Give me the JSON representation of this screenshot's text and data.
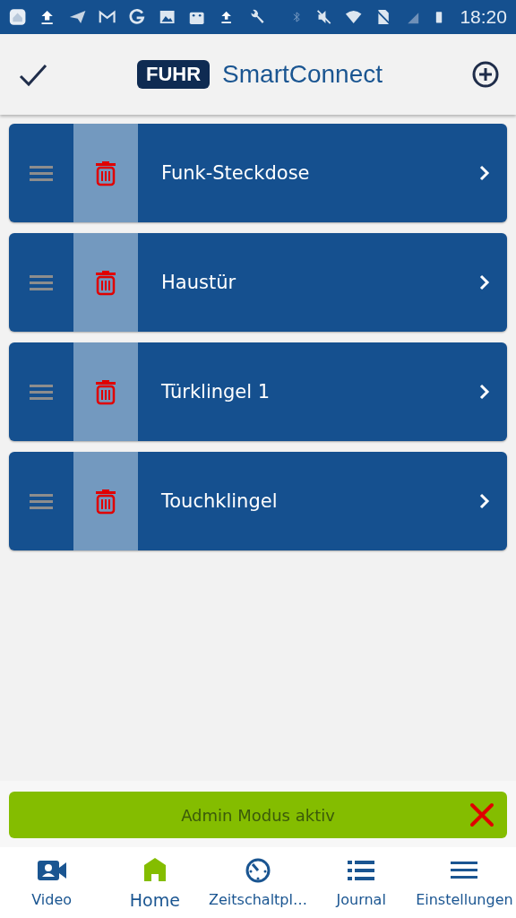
{
  "status_bar": {
    "time": "18:20"
  },
  "header": {
    "brand_badge": "FUHR",
    "brand_name": "SmartConnect"
  },
  "devices": [
    {
      "name": "Funk-Steckdose"
    },
    {
      "name": "Haustür"
    },
    {
      "name": "Türklingel 1"
    },
    {
      "name": "Touchklingel"
    }
  ],
  "admin_banner": {
    "text": "Admin Modus aktiv"
  },
  "bottom_nav": [
    {
      "label": "Video",
      "selected": false
    },
    {
      "label": "Home",
      "selected": true
    },
    {
      "label": "Zeitschaltpl…",
      "selected": false
    },
    {
      "label": "Journal",
      "selected": false
    },
    {
      "label": "Einstellungen",
      "selected": false
    }
  ]
}
